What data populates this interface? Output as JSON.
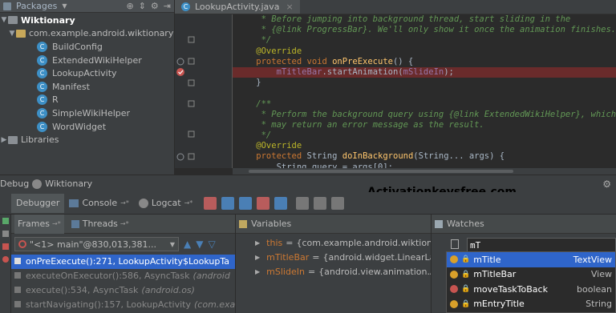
{
  "project_panel": {
    "view_label": "Packages",
    "root": "Wiktionary",
    "package": "com.example.android.wiktionary",
    "classes": [
      "BuildConfig",
      "ExtendedWikiHelper",
      "LookupActivity",
      "Manifest",
      "R",
      "SimpleWikiHelper",
      "WordWidget"
    ],
    "libraries": "Libraries"
  },
  "editor": {
    "tab_title": "LookupActivity.java",
    "lines": [
      {
        "segments": [
          {
            "t": "     * Before jumping into background thread, start sliding in the",
            "c": "cm"
          }
        ]
      },
      {
        "segments": [
          {
            "t": "     * {@link ProgressBar}. We'll only show it once the animation finishes.",
            "c": "cm"
          }
        ]
      },
      {
        "segments": [
          {
            "t": "     */",
            "c": "cm"
          }
        ]
      },
      {
        "segments": [
          {
            "t": "    @Override",
            "c": "an"
          }
        ]
      },
      {
        "segments": [
          {
            "t": "    protected void ",
            "c": "kw"
          },
          {
            "t": "onPreExecute",
            "c": "fn"
          },
          {
            "t": "() {",
            "c": "pl"
          }
        ]
      },
      {
        "highlight": true,
        "segments": [
          {
            "t": "        ",
            "c": "pl"
          },
          {
            "t": "mTitleBar",
            "c": "fld"
          },
          {
            "t": ".startAnimation(",
            "c": "pl"
          },
          {
            "t": "mSlideIn",
            "c": "fld"
          },
          {
            "t": ");",
            "c": "pl"
          }
        ]
      },
      {
        "segments": [
          {
            "t": "    }",
            "c": "pl"
          }
        ]
      },
      {
        "segments": [
          {
            "t": "",
            "c": "pl"
          }
        ]
      },
      {
        "segments": [
          {
            "t": "    /**",
            "c": "cm"
          }
        ]
      },
      {
        "segments": [
          {
            "t": "     * Perform the background query using {@link ExtendedWikiHelper}, which",
            "c": "cm"
          }
        ]
      },
      {
        "segments": [
          {
            "t": "     * may return an error message as the result.",
            "c": "cm"
          }
        ]
      },
      {
        "segments": [
          {
            "t": "     */",
            "c": "cm"
          }
        ]
      },
      {
        "segments": [
          {
            "t": "    @Override",
            "c": "an"
          }
        ]
      },
      {
        "segments": [
          {
            "t": "    protected ",
            "c": "kw"
          },
          {
            "t": "String ",
            "c": "pl"
          },
          {
            "t": "doInBackground",
            "c": "fn"
          },
          {
            "t": "(String... args) {",
            "c": "pl"
          }
        ]
      },
      {
        "segments": [
          {
            "t": "        String query = args[0];",
            "c": "pl"
          }
        ]
      }
    ]
  },
  "debug": {
    "label": "Debug",
    "config": "Wiktionary",
    "tabs": [
      "Debugger",
      "Console",
      "Logcat"
    ]
  },
  "watermark": "Activationkeysfree.com",
  "frames": {
    "tab_frames": "Frames",
    "tab_threads": "Threads",
    "thread": "\"<1> main\"@830,013,381...",
    "rows": [
      {
        "text": "onPreExecute():271, LookupActivity$LookupTa",
        "extra": "",
        "selected": true
      },
      {
        "text": "executeOnExecutor():586, AsyncTask",
        "extra": "(android",
        "selected": false
      },
      {
        "text": "execute():534, AsyncTask",
        "extra": "(android.os)",
        "selected": false
      },
      {
        "text": "startNavigating():157, LookupActivity",
        "extra": "(com.exa",
        "selected": false
      }
    ]
  },
  "variables": {
    "title": "Variables",
    "rows": [
      {
        "name": "this",
        "value": "{com.example.android.wiktionar"
      },
      {
        "name": "mTitleBar",
        "value": "{android.widget.LinearLayo"
      },
      {
        "name": "mSlideIn",
        "value": "{android.view.animation.Ani"
      }
    ]
  },
  "watches": {
    "title": "Watches",
    "input": "mT",
    "suggestions": [
      {
        "name": "mTitle",
        "type": "TextView",
        "kind": "field",
        "selected": true
      },
      {
        "name": "mTitleBar",
        "type": "View",
        "kind": "field",
        "selected": false
      },
      {
        "name": "moveTaskToBack",
        "type": "boolean",
        "kind": "method",
        "selected": false
      },
      {
        "name": "mEntryTitle",
        "type": "String",
        "kind": "field",
        "selected": false
      }
    ]
  },
  "colors": {
    "accent": "#2f65ca",
    "breakpoint_line": "#6a2b2b",
    "editor_bg": "#2b2b2b",
    "panel_bg": "#3c3f41"
  }
}
